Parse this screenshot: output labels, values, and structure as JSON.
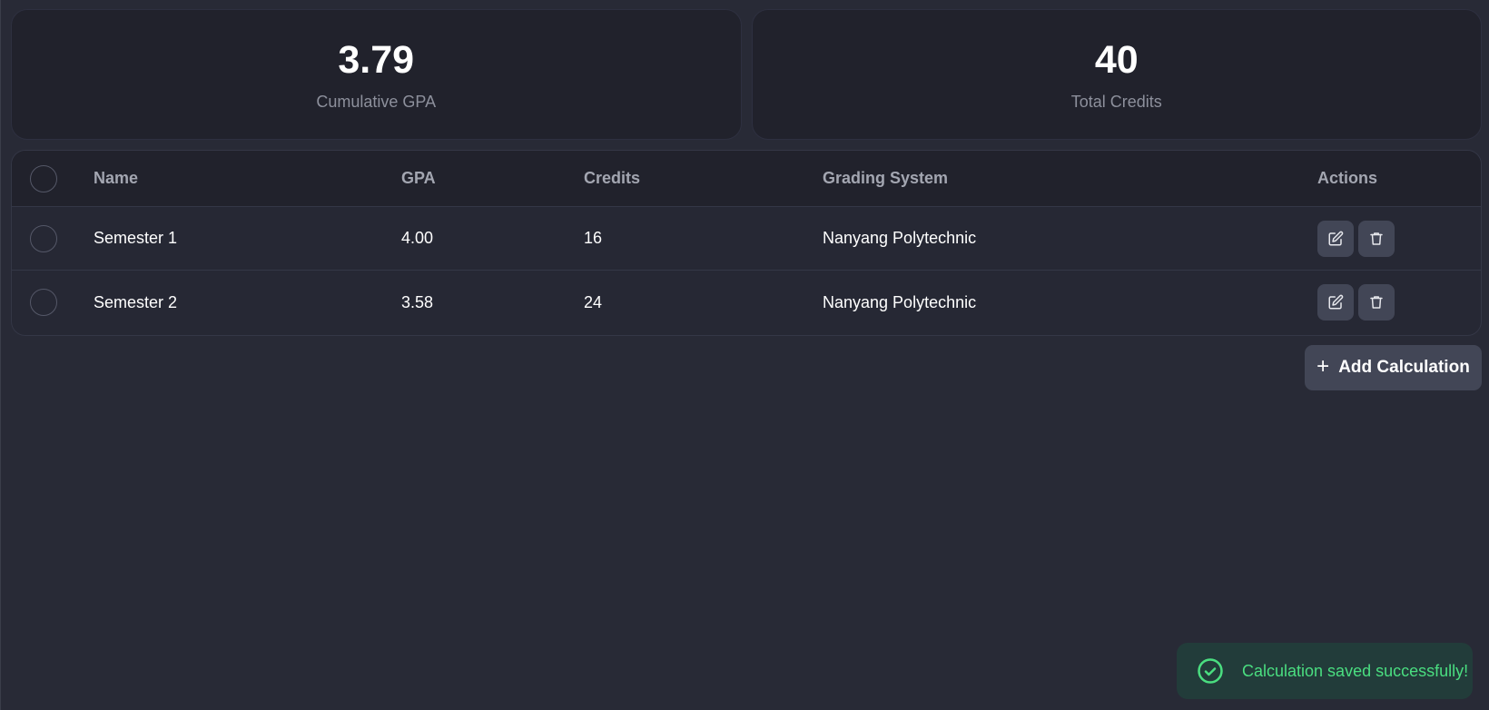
{
  "summary": {
    "cumulative_gpa": {
      "value": "3.79",
      "label": "Cumulative GPA"
    },
    "total_credits": {
      "value": "40",
      "label": "Total Credits"
    }
  },
  "table": {
    "headers": {
      "name": "Name",
      "gpa": "GPA",
      "credits": "Credits",
      "grading": "Grading System",
      "actions": "Actions"
    },
    "rows": [
      {
        "name": "Semester 1",
        "gpa": "4.00",
        "credits": "16",
        "grading": "Nanyang Polytechnic"
      },
      {
        "name": "Semester 2",
        "gpa": "3.58",
        "credits": "24",
        "grading": "Nanyang Polytechnic"
      }
    ]
  },
  "actions": {
    "add_label": "Add Calculation",
    "row_icons": [
      "edit-icon",
      "trash-icon"
    ]
  },
  "toast": {
    "message": "Calculation saved successfully!",
    "icon": "check-circle-icon",
    "color": "#4ade80"
  },
  "colors": {
    "background": "#282a36",
    "card": "#21222c",
    "button": "#424656"
  }
}
